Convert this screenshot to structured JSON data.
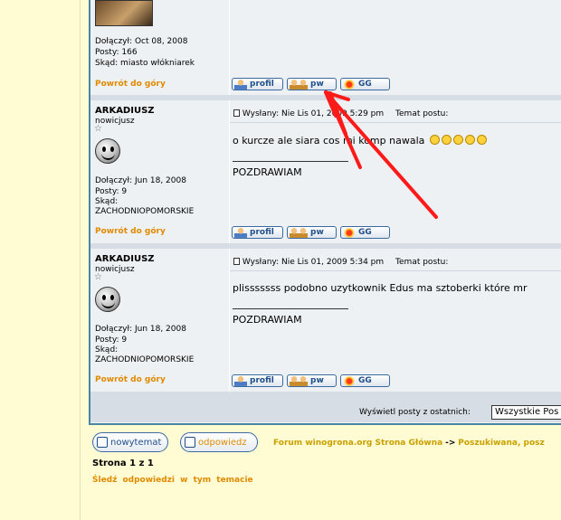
{
  "post1": {
    "joined": "Dołączył: Oct 08, 2008",
    "posts": "Posty: 166",
    "from": "Skąd: miasto włókniarek",
    "back_to_top": "Powrót do góry",
    "buttons": {
      "profile": "profil",
      "pw": "pw",
      "gg": "GG"
    }
  },
  "post2": {
    "username": "ARKADIUSZ",
    "rank": "nowicjusz",
    "joined": "Dołączył: Jun 18, 2008",
    "posts": "Posty: 9",
    "from_label": "Skąd:",
    "from": "ZACHODNIOPOMORSKIE",
    "posted": "Wysłany: Nie Lis 01, 2009 5:29 pm",
    "subject": "Temat postu:",
    "text": "o kurcze ale siara cos mi komp nawala",
    "signature": "POZDRAWIAM",
    "back_to_top": "Powrót do góry",
    "buttons": {
      "profile": "profil",
      "pw": "pw",
      "gg": "GG"
    }
  },
  "post3": {
    "username": "ARKADIUSZ",
    "rank": "nowicjusz",
    "joined": "Dołączył: Jun 18, 2008",
    "posts": "Posty: 9",
    "from_label": "Skąd:",
    "from": "ZACHODNIOPOMORSKIE",
    "posted": "Wysłany: Nie Lis 01, 2009 5:34 pm",
    "subject": "Temat postu:",
    "text": "plisssssss podobno uzytkownik Edus ma sztoberki które mr",
    "signature": "POZDRAWIAM",
    "back_to_top": "Powrót do góry",
    "buttons": {
      "profile": "profil",
      "pw": "pw",
      "gg": "GG"
    }
  },
  "footer": {
    "show_posts_label": "Wyświetl posty z ostatnich:",
    "show_posts_value": "Wszystkie Pos",
    "new_topic": "nowytemat",
    "reply": "odpowiedz",
    "forum_index": "Forum winogrona.org Strona Główna",
    "arrow": "->",
    "crumb": "Poszukiwana, posz",
    "page": "Strona 1 z 1",
    "watch": "Śledź odpowiedzi w tym temacie"
  }
}
